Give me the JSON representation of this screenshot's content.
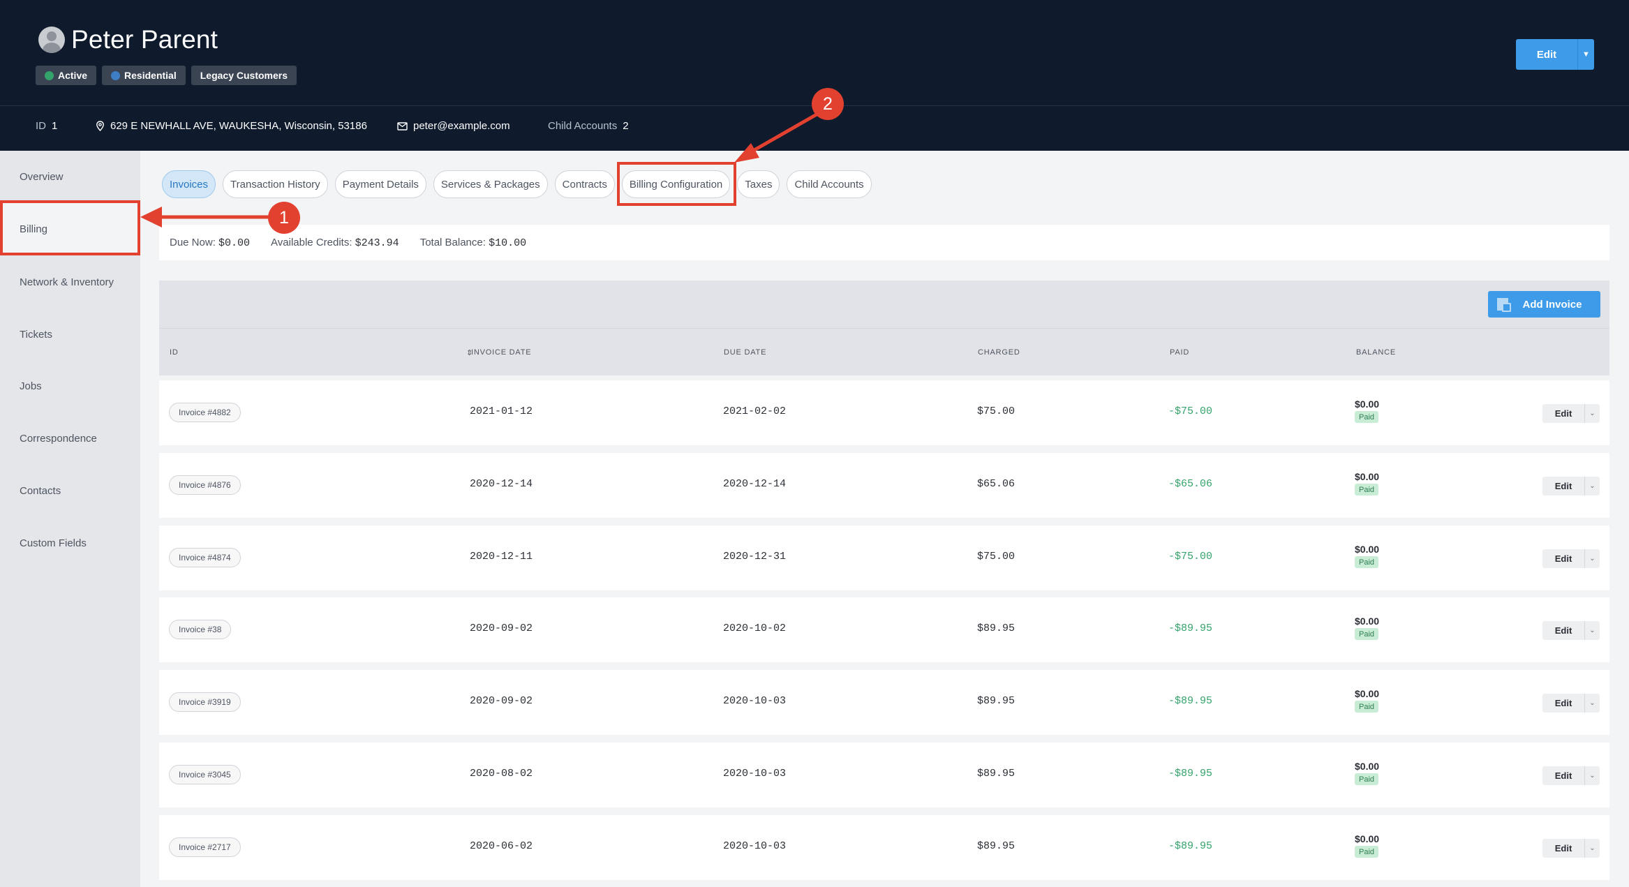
{
  "customer": {
    "name": "Peter Parent",
    "badges": [
      {
        "label": "Active",
        "dot_color": "#34a36b"
      },
      {
        "label": "Residential",
        "dot_color": "#3d7fc4"
      },
      {
        "label": "Legacy Customers",
        "dot_color": ""
      }
    ],
    "edit_label": "Edit"
  },
  "meta": {
    "id_key": "ID",
    "id_value": "1",
    "address": "629 E NEWHALL AVE, WAUKESHA, Wisconsin, 53186",
    "email": "peter@example.com",
    "child_key": "Child Accounts",
    "child_value": "2"
  },
  "sidebar": {
    "items": [
      "Overview",
      "Billing",
      "Network & Inventory",
      "Tickets",
      "Jobs",
      "Correspondence",
      "Contacts",
      "Custom Fields"
    ],
    "active": "Billing"
  },
  "tabs": [
    "Invoices",
    "Transaction History",
    "Payment Details",
    "Services & Packages",
    "Contracts",
    "Billing Configuration",
    "Taxes",
    "Child Accounts"
  ],
  "balance": {
    "due_label": "Due Now:",
    "due_value": "$0.00",
    "credits_label": "Available Credits:",
    "credits_value": "$243.94",
    "total_label": "Total Balance:",
    "total_value": "$10.00"
  },
  "table": {
    "add_label": "Add Invoice",
    "columns": [
      "ID",
      "INVOICE DATE",
      "DUE DATE",
      "CHARGED",
      "PAID",
      "BALANCE"
    ],
    "rows": [
      {
        "id": "Invoice #4882",
        "invoice_date": "2021-01-12",
        "due_date": "2021-02-02",
        "charged": "$75.00",
        "paid": "-$75.00",
        "balance": "$0.00",
        "status": "Paid",
        "edit": "Edit"
      },
      {
        "id": "Invoice #4876",
        "invoice_date": "2020-12-14",
        "due_date": "2020-12-14",
        "charged": "$65.06",
        "paid": "-$65.06",
        "balance": "$0.00",
        "status": "Paid",
        "edit": "Edit"
      },
      {
        "id": "Invoice #4874",
        "invoice_date": "2020-12-11",
        "due_date": "2020-12-31",
        "charged": "$75.00",
        "paid": "-$75.00",
        "balance": "$0.00",
        "status": "Paid",
        "edit": "Edit"
      },
      {
        "id": "Invoice #38",
        "invoice_date": "2020-09-02",
        "due_date": "2020-10-02",
        "charged": "$89.95",
        "paid": "-$89.95",
        "balance": "$0.00",
        "status": "Paid",
        "edit": "Edit"
      },
      {
        "id": "Invoice #3919",
        "invoice_date": "2020-09-02",
        "due_date": "2020-10-03",
        "charged": "$89.95",
        "paid": "-$89.95",
        "balance": "$0.00",
        "status": "Paid",
        "edit": "Edit"
      },
      {
        "id": "Invoice #3045",
        "invoice_date": "2020-08-02",
        "due_date": "2020-10-03",
        "charged": "$89.95",
        "paid": "-$89.95",
        "balance": "$0.00",
        "status": "Paid",
        "edit": "Edit"
      },
      {
        "id": "Invoice #2717",
        "invoice_date": "2020-06-02",
        "due_date": "2020-10-03",
        "charged": "$89.95",
        "paid": "-$89.95",
        "balance": "$0.00",
        "status": "Paid",
        "edit": "Edit"
      }
    ]
  },
  "annotations": {
    "marker_1": "1",
    "marker_2": "2",
    "color": "#e3412f"
  }
}
